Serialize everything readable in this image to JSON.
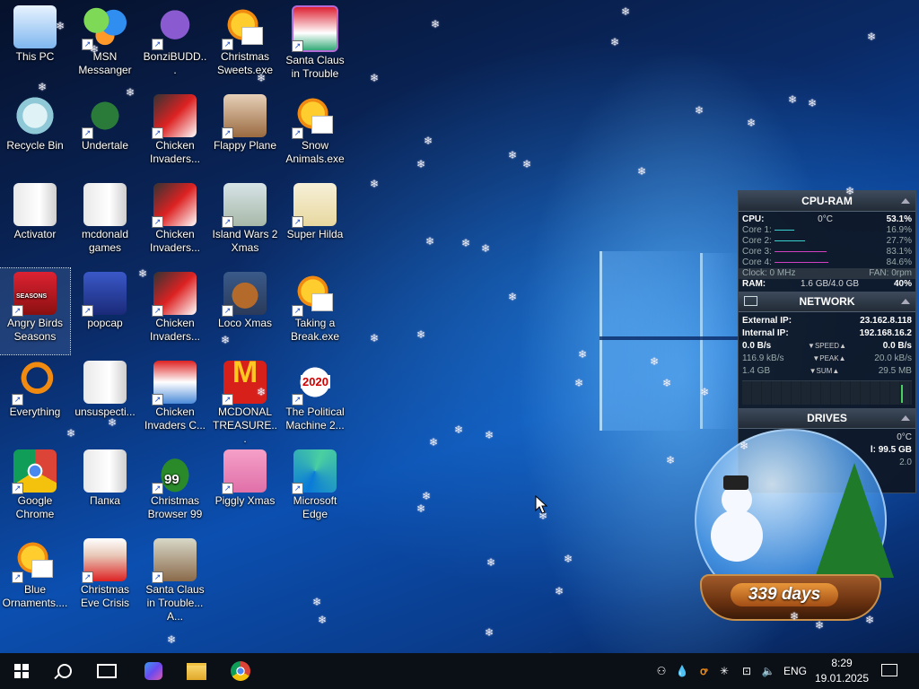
{
  "desktop": {
    "icons": [
      {
        "label": "This PC",
        "icon": "computer-icon"
      },
      {
        "label": "MSN Messanger",
        "icon": "msn-icon"
      },
      {
        "label": "BonziBUDD...",
        "icon": "bonzi-icon"
      },
      {
        "label": "Christmas Sweets.exe",
        "icon": "star-icon"
      },
      {
        "label": "Santa Claus in Trouble",
        "icon": "santa-icon"
      },
      {
        "label": "Recycle Bin",
        "icon": "recycle-bin-icon"
      },
      {
        "label": "Undertale",
        "icon": "undertale-icon"
      },
      {
        "label": "Chicken Invaders...",
        "icon": "chicken-invaders-icon"
      },
      {
        "label": "Flappy Plane",
        "icon": "flappy-plane-icon"
      },
      {
        "label": "Snow Animals.exe",
        "icon": "star-icon"
      },
      {
        "label": "Activator",
        "icon": "folder-icon"
      },
      {
        "label": "mcdonald games",
        "icon": "folder-icon"
      },
      {
        "label": "Chicken Invaders...",
        "icon": "chicken-invaders-icon"
      },
      {
        "label": "Island Wars 2 Xmas",
        "icon": "island-wars-icon"
      },
      {
        "label": "Super Hilda",
        "icon": "super-hilda-icon"
      },
      {
        "label": "Angry Birds Seasons",
        "icon": "angry-birds-icon"
      },
      {
        "label": "popcap",
        "icon": "popcap-icon"
      },
      {
        "label": "Chicken Invaders...",
        "icon": "chicken-invaders-icon"
      },
      {
        "label": "Loco Xmas",
        "icon": "teddy-bear-icon"
      },
      {
        "label": "Taking a Break.exe",
        "icon": "star-icon"
      },
      {
        "label": "Everything",
        "icon": "everything-search-icon"
      },
      {
        "label": "unsuspecti...",
        "icon": "folder-icon"
      },
      {
        "label": "Chicken Invaders C...",
        "icon": "snowman-icon"
      },
      {
        "label": "MCDONAL TREASURE...",
        "icon": "mcdonalds-icon"
      },
      {
        "label": "The Political Machine 2...",
        "icon": "political-machine-icon"
      },
      {
        "label": "Google Chrome",
        "icon": "chrome-icon"
      },
      {
        "label": "Папка",
        "icon": "folder-icon"
      },
      {
        "label": "Christmas Browser 99",
        "icon": "christmas-tree-icon"
      },
      {
        "label": "Piggly Xmas",
        "icon": "pig-icon"
      },
      {
        "label": "Microsoft Edge",
        "icon": "edge-icon"
      },
      {
        "label": "Blue Ornaments....",
        "icon": "star-icon"
      },
      {
        "label": "Christmas Eve Crisis",
        "icon": "santa-face-icon"
      },
      {
        "label": "Santa Claus in Trouble... A...",
        "icon": "santa-icon"
      }
    ],
    "icon_badges": {
      "santa2020": "2020",
      "tree99": "99",
      "angry": "SEASONS"
    }
  },
  "widget": {
    "cpu_ram": {
      "title": "CPU-RAM",
      "cpu_label": "CPU:",
      "cpu_temp": "0°C",
      "cpu_value": "53.1%",
      "cores": [
        {
          "label": "Core 1:",
          "value": "16.9%"
        },
        {
          "label": "Core 2:",
          "value": "27.7%"
        },
        {
          "label": "Core 3:",
          "value": "83.1%"
        },
        {
          "label": "Core 4:",
          "value": "84.6%"
        }
      ],
      "clock": "Clock: 0 MHz",
      "fan": "FAN: 0rpm",
      "ram_label": "RAM:",
      "ram_value": "1.6 GB/4.0 GB",
      "ram_pct": "40%"
    },
    "network": {
      "title": "NETWORK",
      "external_label": "External IP:",
      "external_ip": "23.162.8.118",
      "internal_label": "Internal IP:",
      "internal_ip": "192.168.16.2",
      "speed_left": "0.0 B/s",
      "speed_label": "SPEED",
      "speed_right": "0.0 B/s",
      "peak_left": "116.9 kB/s",
      "peak_label": "PEAK",
      "peak_right": "20.0 kB/s",
      "sum_left": "1.4 GB",
      "sum_label": "SUM",
      "sum_right": "29.5 MB"
    },
    "drives": {
      "title": "DRIVES",
      "temp": "0°C",
      "size": "l: 99.5 GB",
      "extra": "2.0"
    }
  },
  "globe": {
    "days": "339 days"
  },
  "taskbar": {
    "language": "ENG",
    "time": "8:29",
    "date": "19.01.2025"
  }
}
